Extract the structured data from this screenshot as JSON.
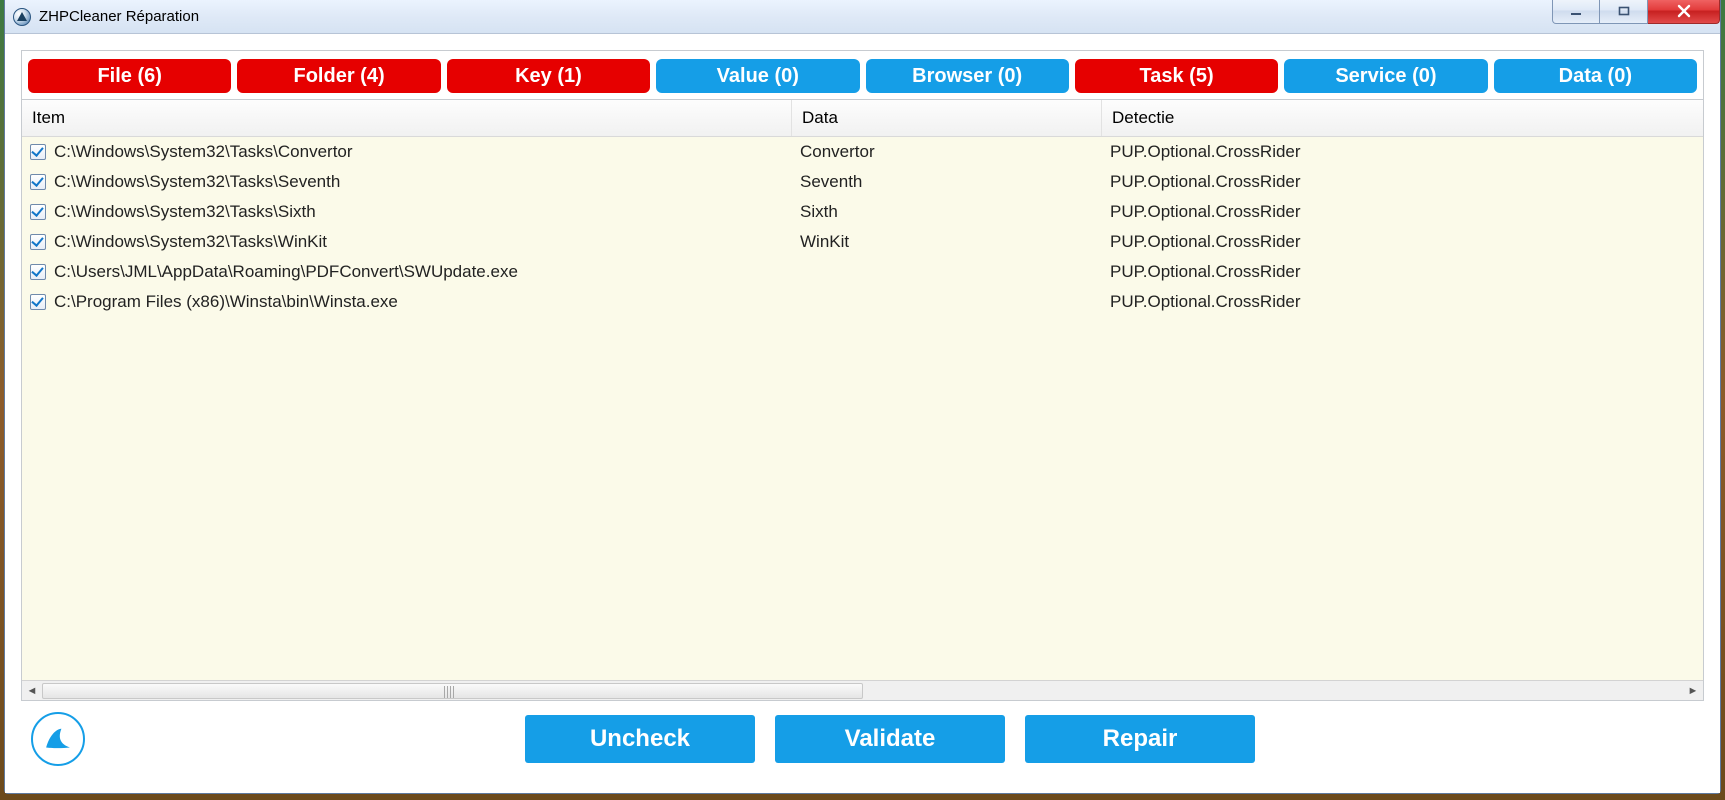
{
  "window": {
    "title": "ZHPCleaner Réparation"
  },
  "tabs": [
    {
      "label": "File  (6)",
      "color": "red"
    },
    {
      "label": "Folder  (4)",
      "color": "red"
    },
    {
      "label": "Key  (1)",
      "color": "red"
    },
    {
      "label": "Value  (0)",
      "color": "blue"
    },
    {
      "label": "Browser  (0)",
      "color": "blue"
    },
    {
      "label": "Task  (5)",
      "color": "red"
    },
    {
      "label": "Service  (0)",
      "color": "blue"
    },
    {
      "label": "Data  (0)",
      "color": "blue"
    }
  ],
  "columns": {
    "item": "Item",
    "data": "Data",
    "detectie": "Detectie"
  },
  "rows": [
    {
      "item": "C:\\Windows\\System32\\Tasks\\Convertor",
      "data": "Convertor",
      "detectie": "PUP.Optional.CrossRider"
    },
    {
      "item": "C:\\Windows\\System32\\Tasks\\Seventh",
      "data": "Seventh",
      "detectie": "PUP.Optional.CrossRider"
    },
    {
      "item": "C:\\Windows\\System32\\Tasks\\Sixth",
      "data": "Sixth",
      "detectie": "PUP.Optional.CrossRider"
    },
    {
      "item": "C:\\Windows\\System32\\Tasks\\WinKit",
      "data": "WinKit",
      "detectie": "PUP.Optional.CrossRider"
    },
    {
      "item": "C:\\Users\\JML\\AppData\\Roaming\\PDFConvert\\SWUpdate.exe",
      "data": "",
      "detectie": "PUP.Optional.CrossRider"
    },
    {
      "item": "C:\\Program Files (x86)\\Winsta\\bin\\Winsta.exe",
      "data": "",
      "detectie": "PUP.Optional.CrossRider"
    }
  ],
  "footer": {
    "uncheck": "Uncheck",
    "validate": "Validate",
    "repair": "Repair"
  },
  "icons": {
    "minimize": "minimize-icon",
    "maximize": "maximize-icon",
    "close": "close-icon",
    "app": "app-icon",
    "logo": "shark-fin-logo"
  }
}
